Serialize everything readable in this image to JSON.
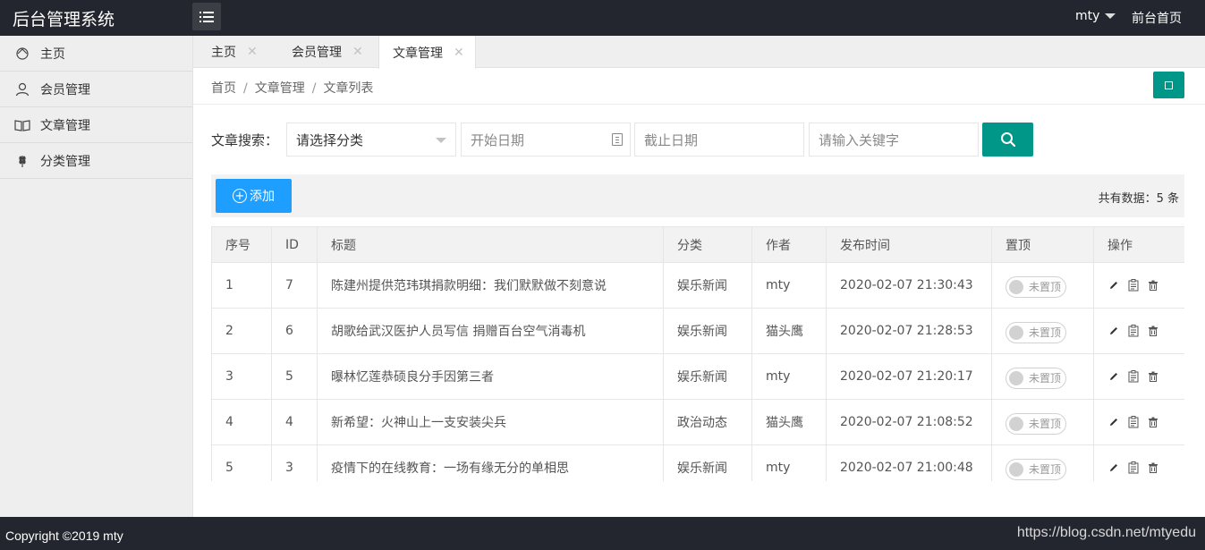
{
  "header": {
    "logo": "后台管理系统",
    "user": "mty",
    "front_link": "前台首页"
  },
  "sidebar": {
    "items": [
      {
        "label": "主页",
        "icon": "home-icon"
      },
      {
        "label": "会员管理",
        "icon": "user-icon"
      },
      {
        "label": "文章管理",
        "icon": "book-icon"
      },
      {
        "label": "分类管理",
        "icon": "wheat-icon"
      }
    ]
  },
  "tabs": [
    {
      "label": "主页",
      "active": false
    },
    {
      "label": "会员管理",
      "active": false
    },
    {
      "label": "文章管理",
      "active": true
    }
  ],
  "breadcrumb": [
    "首页",
    "文章管理",
    "文章列表"
  ],
  "search": {
    "label": "文章搜索：",
    "category_placeholder": "请选择分类",
    "start_placeholder": "开始日期",
    "end_placeholder": "截止日期",
    "keyword_placeholder": "请输入关键字"
  },
  "toolbar": {
    "add_label": "添加",
    "total": "共有数据：5 条"
  },
  "table": {
    "headers": [
      "序号",
      "ID",
      "标题",
      "分类",
      "作者",
      "发布时间",
      "置顶",
      "操作"
    ],
    "rows": [
      {
        "index": "1",
        "id": "7",
        "title": "陈建州提供范玮琪捐款明细：我们默默做不刻意说",
        "category": "娱乐新闻",
        "author": "mty",
        "time": "2020-02-07 21:30:43",
        "top": "未置顶"
      },
      {
        "index": "2",
        "id": "6",
        "title": "胡歌给武汉医护人员写信 捐赠百台空气消毒机",
        "category": "娱乐新闻",
        "author": "猫头鹰",
        "time": "2020-02-07 21:28:53",
        "top": "未置顶"
      },
      {
        "index": "3",
        "id": "5",
        "title": "曝林忆莲恭硕良分手因第三者",
        "category": "娱乐新闻",
        "author": "mty",
        "time": "2020-02-07 21:20:17",
        "top": "未置顶"
      },
      {
        "index": "4",
        "id": "4",
        "title": "新希望：火神山上一支安装尖兵",
        "category": "政治动态",
        "author": "猫头鹰",
        "time": "2020-02-07 21:08:52",
        "top": "未置顶"
      },
      {
        "index": "5",
        "id": "3",
        "title": "疫情下的在线教育：一场有缘无分的单相思",
        "category": "娱乐新闻",
        "author": "mty",
        "time": "2020-02-07 21:00:48",
        "top": "未置顶"
      }
    ]
  },
  "footer": {
    "copyright": "Copyright ©2019 mty",
    "watermark": "https://blog.csdn.net/mtyedu"
  },
  "colors": {
    "header_bg": "#23262e",
    "primary_green": "#009688",
    "primary_blue": "#1e9fff"
  }
}
